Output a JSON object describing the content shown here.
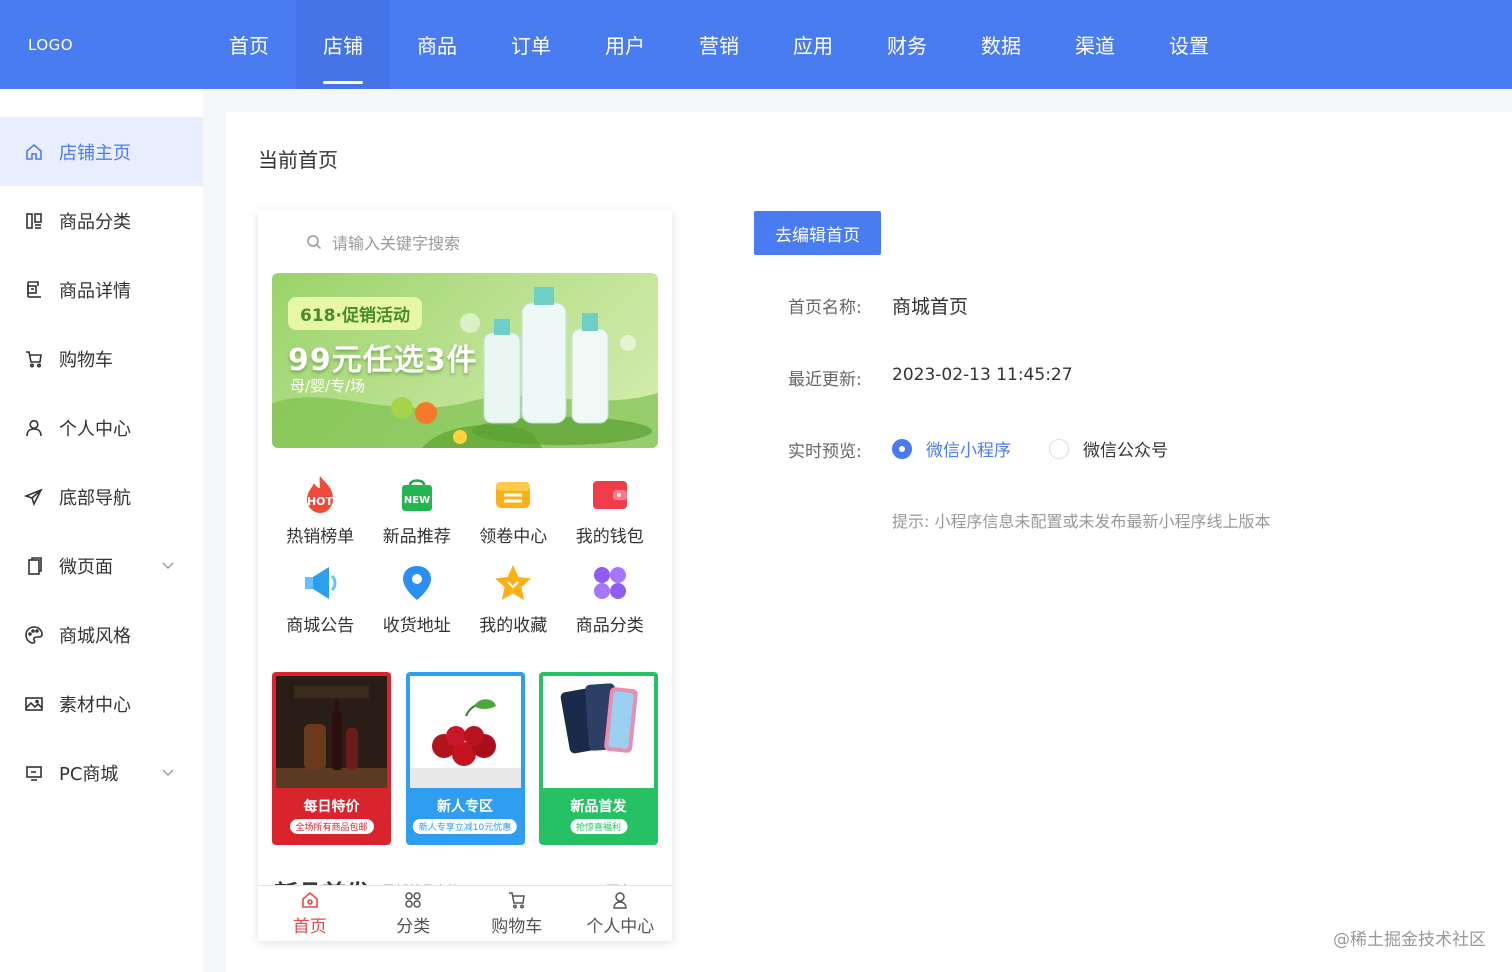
{
  "header": {
    "logo": "LOGO",
    "nav": [
      {
        "label": "首页",
        "active": false
      },
      {
        "label": "店铺",
        "active": true
      },
      {
        "label": "商品",
        "active": false
      },
      {
        "label": "订单",
        "active": false
      },
      {
        "label": "用户",
        "active": false
      },
      {
        "label": "营销",
        "active": false
      },
      {
        "label": "应用",
        "active": false
      },
      {
        "label": "财务",
        "active": false
      },
      {
        "label": "数据",
        "active": false
      },
      {
        "label": "渠道",
        "active": false
      },
      {
        "label": "设置",
        "active": false
      }
    ]
  },
  "sidebar": {
    "items": [
      {
        "label": "店铺主页",
        "icon": "home-icon",
        "active": true
      },
      {
        "label": "商品分类",
        "icon": "category-icon"
      },
      {
        "label": "商品详情",
        "icon": "detail-icon"
      },
      {
        "label": "购物车",
        "icon": "cart-icon"
      },
      {
        "label": "个人中心",
        "icon": "user-icon"
      },
      {
        "label": "底部导航",
        "icon": "send-icon"
      },
      {
        "label": "微页面",
        "icon": "page-icon",
        "expandable": true
      },
      {
        "label": "商城风格",
        "icon": "palette-icon"
      },
      {
        "label": "素材中心",
        "icon": "image-icon"
      },
      {
        "label": "PC商城",
        "icon": "monitor-icon",
        "expandable": true
      }
    ]
  },
  "main": {
    "title": "当前首页",
    "edit_button": "去编辑首页",
    "name_label": "首页名称:",
    "name_value": "商城首页",
    "updated_label": "最近更新:",
    "updated_value": "2023-02-13 11:45:27",
    "preview_label": "实时预览:",
    "preview_options": [
      {
        "label": "微信小程序",
        "checked": true
      },
      {
        "label": "微信公众号",
        "checked": false
      }
    ],
    "hint": "提示: 小程序信息未配置或未发布最新小程序线上版本"
  },
  "phone": {
    "search_placeholder": "请输入关键字搜索",
    "banner": {
      "tag": "618·促销活动",
      "main": "99元任选3件",
      "sub": "母/婴/专/场"
    },
    "grid": [
      {
        "label": "热销榜单",
        "icon": "hot-icon",
        "badge": "HOT"
      },
      {
        "label": "新品推荐",
        "icon": "new-bag-icon",
        "badge": "NEW"
      },
      {
        "label": "领卷中心",
        "icon": "coupon-icon"
      },
      {
        "label": "我的钱包",
        "icon": "wallet-icon"
      },
      {
        "label": "商城公告",
        "icon": "megaphone-icon"
      },
      {
        "label": "收货地址",
        "icon": "location-icon"
      },
      {
        "label": "我的收藏",
        "icon": "star-icon"
      },
      {
        "label": "商品分类",
        "icon": "clover-icon"
      }
    ],
    "cards": [
      {
        "title": "每日特价",
        "sub": "全场所有商品包邮",
        "color": "#d9232d"
      },
      {
        "title": "新人专区",
        "sub": "新人专享立减10元优惠",
        "color": "#2f9ef0"
      },
      {
        "title": "新品首发",
        "sub": "抢惊喜福利",
        "color": "#27c165"
      }
    ],
    "section_title": "新品首发",
    "section_sub": "最新单品走势",
    "section_more": "更多 >",
    "tabs": [
      {
        "label": "首页",
        "icon": "home-tab-icon",
        "active": true
      },
      {
        "label": "分类",
        "icon": "grid-tab-icon"
      },
      {
        "label": "购物车",
        "icon": "cart-tab-icon"
      },
      {
        "label": "个人中心",
        "icon": "user-tab-icon"
      }
    ]
  },
  "watermark": "@稀土掘金技术社区",
  "colors": {
    "primary": "#4a7cf1",
    "accent_red": "#e94a4a"
  }
}
